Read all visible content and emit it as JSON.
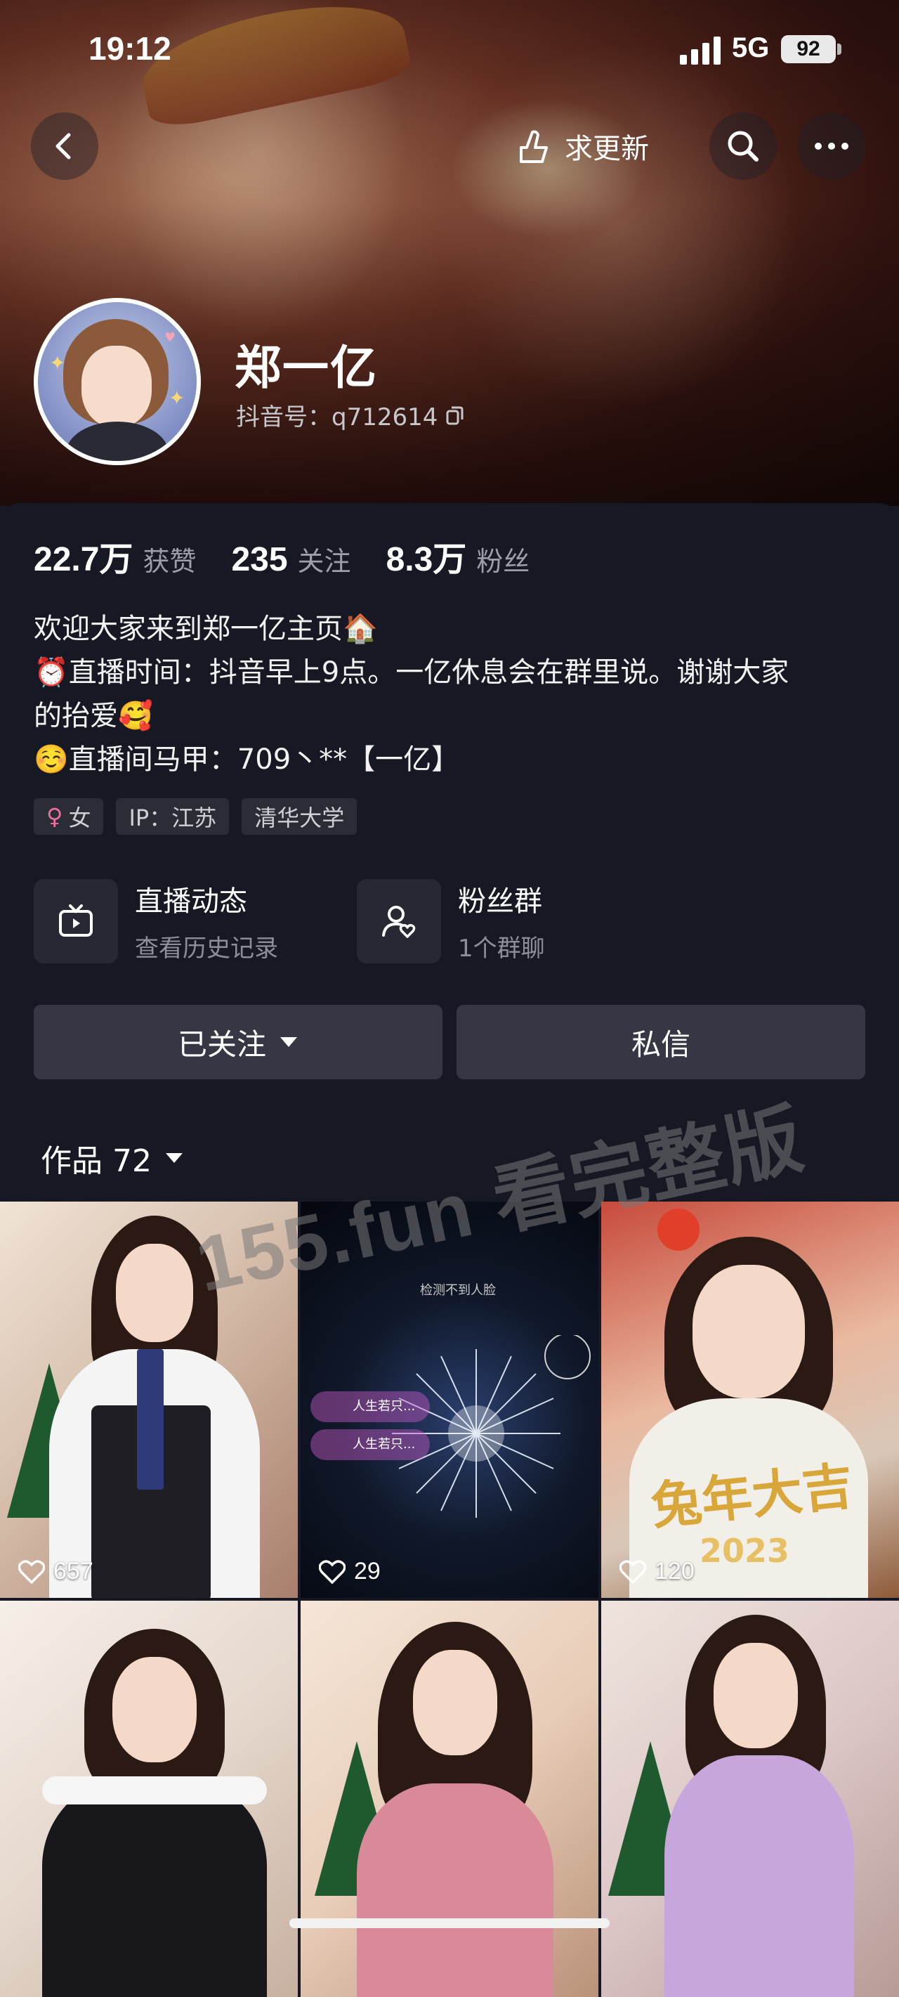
{
  "status_bar": {
    "time": "19:12",
    "network": "5G",
    "battery": "92"
  },
  "header": {
    "request_update_label": "求更新"
  },
  "profile": {
    "name": "郑一亿",
    "douyin_id_label": "抖音号：q712614"
  },
  "stats": [
    {
      "value": "22.7万",
      "label": "获赞"
    },
    {
      "value": "235",
      "label": "关注"
    },
    {
      "value": "8.3万",
      "label": "粉丝"
    }
  ],
  "bio": {
    "line1": "欢迎大家来到郑一亿主页🏠",
    "line2": "⏰直播时间：抖音早上9点。一亿休息会在群里说。谢谢大家",
    "line3": "的抬爱🥰",
    "line4": "☺️直播间马甲：709丶**【一亿】"
  },
  "tags": {
    "gender": "女",
    "ip": "IP：江苏",
    "school": "清华大学"
  },
  "features": {
    "live": {
      "title": "直播动态",
      "subtitle": "查看历史记录"
    },
    "fans": {
      "title": "粉丝群",
      "subtitle": "1个群聊"
    }
  },
  "actions": {
    "followed": "已关注",
    "message": "私信"
  },
  "works": {
    "label": "作品 72"
  },
  "videos": [
    {
      "likes": "657"
    },
    {
      "likes": "29"
    },
    {
      "likes": "120"
    },
    {
      "likes": ""
    },
    {
      "likes": ""
    },
    {
      "likes": ""
    }
  ],
  "video_overlays": {
    "no_face": "检测不到人脸",
    "comment1": "人生若只...",
    "comment2": "人生若只...",
    "banner_text": "兔年大吉",
    "year": "2023"
  },
  "watermark": "155.fun 看完整版",
  "colors": {
    "background": "#161823",
    "button": "#353844",
    "tag": "#2a2c36"
  }
}
